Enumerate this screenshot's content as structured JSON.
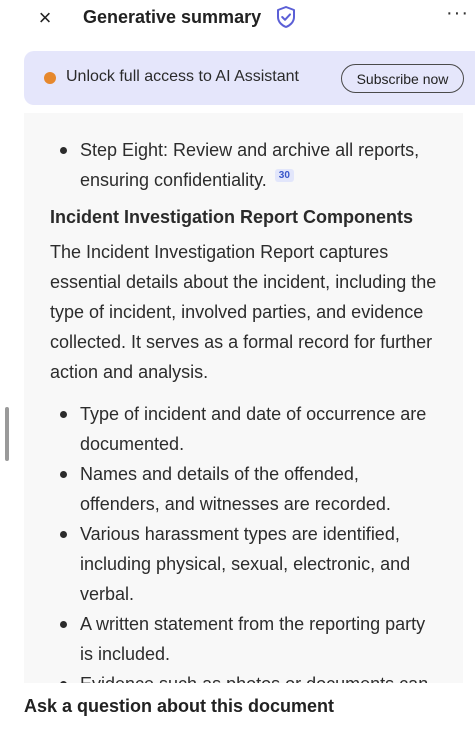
{
  "header": {
    "title": "Generative summary",
    "close_icon": "close-icon",
    "close_glyph": "×",
    "shield_icon": "shield-check-icon",
    "more_icon": "more-icon",
    "more_glyph": "···"
  },
  "banner": {
    "text": "Unlock full access to AI Assistant",
    "button_label": "Subscribe now",
    "dot_color": "#e6882d",
    "background": "#e5e6fb"
  },
  "summary": {
    "top_bullet": {
      "text": "Step Eight: Review and archive all reports, ensuring confidentiality.",
      "citation": "30"
    },
    "heading": "Incident Investigation Report Components",
    "paragraph": "The Incident Investigation Report captures essential details about the incident, including the type of incident, involved parties, and evidence collected. It serves as a formal record for further action and analysis.",
    "bullets": [
      "Type of incident and date of occurrence are documented.",
      "Names and details of the offended, offenders, and witnesses are recorded.",
      "Various harassment types are identified, including physical, sexual, electronic, and verbal.",
      "A written statement from the reporting party is included.",
      "Evidence such as photos or documents can"
    ]
  },
  "footer": {
    "ask_label": "Ask a question about this document"
  },
  "colors": {
    "citation_bg": "#e2e6fb",
    "citation_text": "#3a57c9",
    "accent": "#5b5fd6"
  }
}
